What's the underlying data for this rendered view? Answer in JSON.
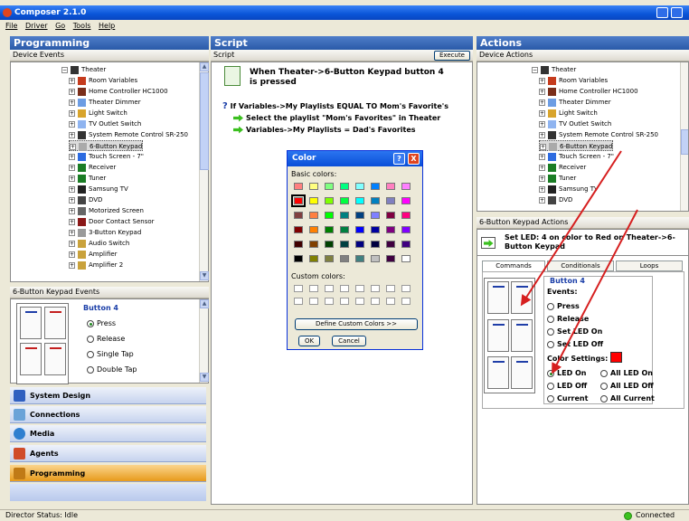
{
  "window": {
    "title": "Composer 2.1.0"
  },
  "menu": [
    "File",
    "Driver",
    "Go",
    "Tools",
    "Help"
  ],
  "programming": {
    "header": "Programming",
    "device_events_label": "Device Events",
    "tree": {
      "root": "Theater",
      "items": [
        "Room Variables",
        "Home Controller HC1000",
        "Theater Dimmer",
        "Light Switch",
        "TV Outlet Switch",
        "System Remote Control SR-250",
        "6-Button Keypad",
        "Touch Screen - 7\"",
        "Receiver",
        "Tuner",
        "Samsung TV",
        "DVD",
        "Motorized Screen",
        "Door Contact Sensor",
        "3-Button Keypad",
        "Audio Switch",
        "Amplifier",
        "Amplifier 2"
      ],
      "selected_index": 6
    },
    "events_label": "6-Button Keypad Events",
    "events_title": "Button 4",
    "events": [
      "Press",
      "Release",
      "Single Tap",
      "Double Tap"
    ],
    "event_selected": "Press"
  },
  "nav": [
    {
      "label": "System Design",
      "color": "#3060c0"
    },
    {
      "label": "Connections",
      "color": "#6aa3d8"
    },
    {
      "label": "Media",
      "color": "#2f7fd0"
    },
    {
      "label": "Agents",
      "color": "#d04c2a"
    },
    {
      "label": "Programming",
      "color": "#c07a16"
    }
  ],
  "script": {
    "header": "Script",
    "sub_label": "Script",
    "execute_label": "Execute",
    "trigger_title": "When Theater->6-Button Keypad button 4 is pressed",
    "condition": "If Variables->My Playlists EQUAL TO Mom's Favorite's",
    "actions": [
      "Select the playlist \"Mom's Favorites\" in Theater",
      "Variables->My Playlists = Dad's Favorites"
    ]
  },
  "color_dialog": {
    "title": "Color",
    "help_glyph": "?",
    "close_glyph": "X",
    "basic_colors_label": "Basic colors:",
    "custom_colors_label": "Custom colors:",
    "define_label": "Define Custom Colors >>",
    "ok_label": "OK",
    "cancel_label": "Cancel",
    "basic_colors": [
      "#ff8080",
      "#ffff80",
      "#80ff80",
      "#00ff80",
      "#80ffff",
      "#0080ff",
      "#ff80c0",
      "#ff80ff",
      "#ff0000",
      "#ffff00",
      "#80ff00",
      "#00ff40",
      "#00ffff",
      "#0080c0",
      "#8080c0",
      "#ff00ff",
      "#804040",
      "#ff8040",
      "#00ff00",
      "#008080",
      "#004080",
      "#8080ff",
      "#800040",
      "#ff0080",
      "#800000",
      "#ff8000",
      "#008000",
      "#008040",
      "#0000ff",
      "#0000a0",
      "#800080",
      "#8000ff",
      "#400000",
      "#804000",
      "#004000",
      "#004040",
      "#000080",
      "#000040",
      "#400040",
      "#400080",
      "#000000",
      "#808000",
      "#808040",
      "#808080",
      "#408080",
      "#c0c0c0",
      "#400040",
      "#ffffff"
    ],
    "selected_index": 8
  },
  "actions_pane": {
    "header": "Actions",
    "device_actions_label": "Device Actions",
    "tree": {
      "root": "Theater",
      "items": [
        "Room Variables",
        "Home Controller HC1000",
        "Theater Dimmer",
        "Light Switch",
        "TV Outlet Switch",
        "System Remote Control SR-250",
        "6-Button Keypad",
        "Touch Screen - 7\"",
        "Receiver",
        "Tuner",
        "Samsung TV",
        "DVD"
      ],
      "selected_index": 6
    },
    "keypad_actions_label": "6-Button Keypad Actions",
    "set_led_text": "Set LED: 4 on color to Red on Theater->6-Button Keypad",
    "tabs": [
      "Commands",
      "Conditionals",
      "Loops"
    ],
    "active_tab": "Commands",
    "button_title": "Button 4",
    "events_label": "Events:",
    "events": [
      "Press",
      "Release",
      "Set LED On",
      "Set LED Off"
    ],
    "color_settings_label": "Color Settings:",
    "color_value": "#ff0000",
    "led_options": [
      "LED On",
      "All LED On",
      "LED Off",
      "All LED Off",
      "Current",
      "All Current"
    ],
    "led_selected": "LED On"
  },
  "status": {
    "left": "Director Status: Idle",
    "right": "Connected"
  }
}
